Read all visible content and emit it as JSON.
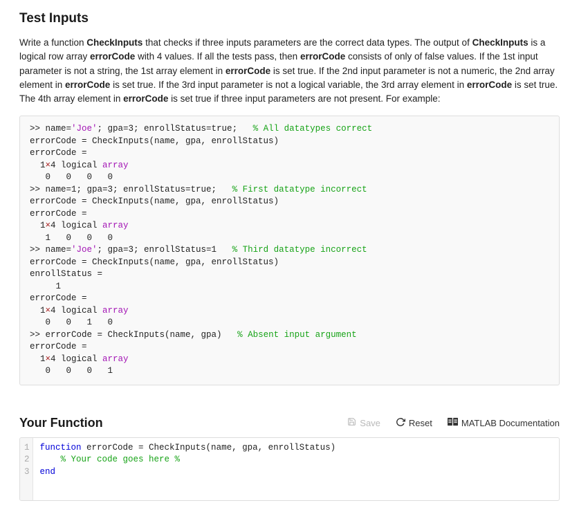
{
  "title": "Test Inputs",
  "desc": {
    "p1a": "Write a function ",
    "p1b": "CheckInputs",
    "p1c": " that checks if three inputs parameters are the correct data types. The output of ",
    "p1d": "CheckInputs",
    "p1e": " is a logical row array ",
    "p1f": "errorCode",
    "p1g": " with 4 values. If all the tests pass, then ",
    "p1h": "errorCode",
    "p1i": " consists of only of false values.   If the 1st input parameter is not a string, the 1st array element in ",
    "p1j": "errorCode",
    "p1k": " is set true.   If the 2nd input parameter is not a numeric, the 2nd array element in ",
    "p1l": "errorCode",
    "p1m": " is set true. If the 3rd input parameter is not a logical variable, the 3rd array element in ",
    "p1n": "errorCode",
    "p1o": " is set true.  The 4th array element in ",
    "p1p": "errorCode",
    "p1q": " is set true if three input parameters are not present.  For example:"
  },
  "example": {
    "l1a": ">> name=",
    "l1b": "'Joe'",
    "l1c": "; gpa=3; enrollStatus=true;   ",
    "l1d": "% All datatypes correct",
    "l2": "errorCode = CheckInputs(name, gpa, enrollStatus)",
    "l3": "errorCode =",
    "l4a": "  1",
    "l4b": "×",
    "l4c": "4 logical ",
    "l4d": "array",
    "l5": "   0   0   0   0",
    "l6a": ">> name=1; gpa=3; enrollStatus=true;   ",
    "l6b": "% First datatype incorrect",
    "l7": "errorCode = CheckInputs(name, gpa, enrollStatus)",
    "l8": "errorCode =",
    "l9a": "  1",
    "l9b": "×",
    "l9c": "4 logical ",
    "l9d": "array",
    "l10": "   1   0   0   0",
    "l11a": ">> name=",
    "l11b": "'Joe'",
    "l11c": "; gpa=3; enrollStatus=1   ",
    "l11d": "% Third datatype incorrect",
    "l12": "errorCode = CheckInputs(name, gpa, enrollStatus)",
    "l13": "enrollStatus =",
    "l14": "     1",
    "l15": "errorCode =",
    "l16a": "  1",
    "l16b": "×",
    "l16c": "4 logical ",
    "l16d": "array",
    "l17": "   0   0   1   0",
    "l18a": ">> errorCode = CheckInputs(name, gpa)   ",
    "l18b": "% Absent input argument",
    "l19": "errorCode =",
    "l20a": "  1",
    "l20b": "×",
    "l20c": "4 logical ",
    "l20d": "array",
    "l21": "   0   0   0   1"
  },
  "section": "Your Function",
  "actions": {
    "save": "Save",
    "reset": "Reset",
    "docs": "MATLAB Documentation"
  },
  "editor": {
    "ln1": "1",
    "ln2": "2",
    "ln3": "3",
    "c1a": "function",
    "c1b": " errorCode = CheckInputs(name, gpa, enrollStatus)",
    "c2a": "    ",
    "c2b": "% Your code goes here %",
    "c3": "end"
  }
}
